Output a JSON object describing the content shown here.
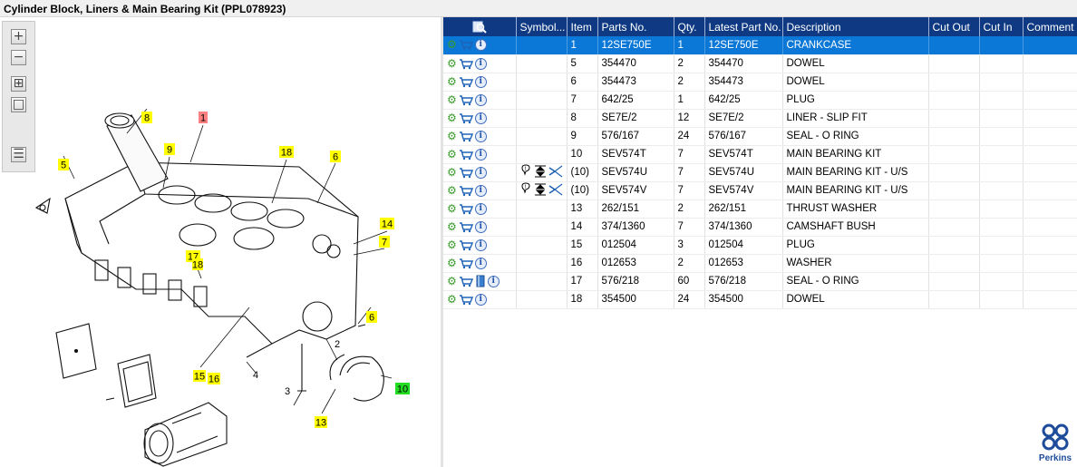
{
  "window": {
    "title": "Cylinder Block, Liners & Main Bearing Kit (PPL078923)"
  },
  "toolbar": {
    "buttons": [
      {
        "name": "zoom-in-button",
        "icon": "zoom-in-icon",
        "glyph": "+"
      },
      {
        "name": "zoom-out-button",
        "icon": "zoom-out-icon",
        "glyph": "−"
      },
      {
        "name": "fit-window-button",
        "icon": "fit-icon",
        "glyph": "⊞"
      },
      {
        "name": "actual-size-button",
        "icon": "actual-size-icon",
        "glyph": "□"
      },
      {
        "name": "export-list-button",
        "icon": "list-arrow-icon",
        "glyph": "☰"
      }
    ]
  },
  "diagram": {
    "callouts": [
      {
        "label": "8",
        "color": "#ffff00"
      },
      {
        "label": "1",
        "color": "#ff8080"
      },
      {
        "label": "5",
        "color": "#ffff00"
      },
      {
        "label": "9",
        "color": "#ffff00"
      },
      {
        "label": "18",
        "color": "#ffff00"
      },
      {
        "label": "6",
        "color": "#ffff00"
      },
      {
        "label": "14",
        "color": "#ffff00"
      },
      {
        "label": "7",
        "color": "#ffff00"
      },
      {
        "label": "17",
        "color": "#ffff00"
      },
      {
        "label": "18",
        "color": "#ffff00"
      },
      {
        "label": "6",
        "color": "#ffff00"
      },
      {
        "label": "15",
        "color": "#ffff00"
      },
      {
        "label": "16",
        "color": "#ffff00"
      },
      {
        "label": "10",
        "color": "#22dd22"
      },
      {
        "label": "13",
        "color": "#ffff00"
      }
    ],
    "plain_labels": [
      "2",
      "3",
      "4"
    ]
  },
  "table": {
    "headers": [
      "",
      "Symbol...",
      "Item",
      "Parts No.",
      "Qty.",
      "Latest Part No.",
      "Description",
      "Cut Out",
      "Cut In",
      "Comment"
    ],
    "rows": [
      {
        "item": "1",
        "part": "12SE750E",
        "qty": "1",
        "latest": "12SE750E",
        "desc": "CRANKCASE",
        "selected": true,
        "symbols": "",
        "book": false
      },
      {
        "item": "5",
        "part": "354470",
        "qty": "2",
        "latest": "354470",
        "desc": "DOWEL",
        "selected": false,
        "symbols": "",
        "book": false
      },
      {
        "item": "6",
        "part": "354473",
        "qty": "2",
        "latest": "354473",
        "desc": "DOWEL",
        "selected": false,
        "symbols": "",
        "book": false
      },
      {
        "item": "7",
        "part": "642/25",
        "qty": "1",
        "latest": "642/25",
        "desc": "PLUG",
        "selected": false,
        "symbols": "",
        "book": false
      },
      {
        "item": "8",
        "part": "SE7E/2",
        "qty": "12",
        "latest": "SE7E/2",
        "desc": "LINER - SLIP FIT",
        "selected": false,
        "symbols": "",
        "book": false
      },
      {
        "item": "9",
        "part": "576/167",
        "qty": "24",
        "latest": "576/167",
        "desc": "SEAL - O RING",
        "selected": false,
        "symbols": "",
        "book": false
      },
      {
        "item": "10",
        "part": "SEV574T",
        "qty": "7",
        "latest": "SEV574T",
        "desc": "MAIN BEARING KIT",
        "selected": false,
        "symbols": "",
        "book": false
      },
      {
        "item": "(10)",
        "part": "SEV574U",
        "qty": "7",
        "latest": "SEV574U",
        "desc": "MAIN BEARING KIT - U/S",
        "selected": false,
        "symbols": "undersize",
        "book": false
      },
      {
        "item": "(10)",
        "part": "SEV574V",
        "qty": "7",
        "latest": "SEV574V",
        "desc": "MAIN BEARING KIT - U/S",
        "selected": false,
        "symbols": "undersize",
        "book": false
      },
      {
        "item": "13",
        "part": "262/151",
        "qty": "2",
        "latest": "262/151",
        "desc": "THRUST WASHER",
        "selected": false,
        "symbols": "",
        "book": false
      },
      {
        "item": "14",
        "part": "374/1360",
        "qty": "7",
        "latest": "374/1360",
        "desc": "CAMSHAFT BUSH",
        "selected": false,
        "symbols": "",
        "book": false
      },
      {
        "item": "15",
        "part": "012504",
        "qty": "3",
        "latest": "012504",
        "desc": "PLUG",
        "selected": false,
        "symbols": "",
        "book": false
      },
      {
        "item": "16",
        "part": "012653",
        "qty": "2",
        "latest": "012653",
        "desc": "WASHER",
        "selected": false,
        "symbols": "",
        "book": false
      },
      {
        "item": "17",
        "part": "576/218",
        "qty": "60",
        "latest": "576/218",
        "desc": "SEAL - O RING",
        "selected": false,
        "symbols": "",
        "book": true
      },
      {
        "item": "18",
        "part": "354500",
        "qty": "24",
        "latest": "354500",
        "desc": "DOWEL",
        "selected": false,
        "symbols": "",
        "book": false
      }
    ]
  },
  "logo": {
    "text": "Perkins"
  },
  "colors": {
    "header": "#0f3a83",
    "selected": "#0b78d7",
    "gear": "#3a9a2c"
  }
}
